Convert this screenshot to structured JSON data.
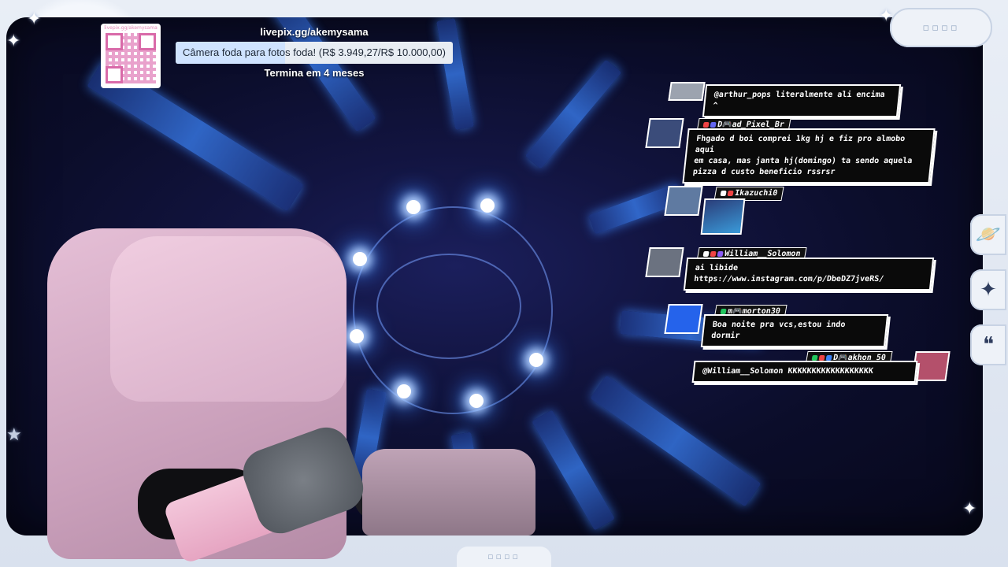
{
  "goal": {
    "url": "livepix.gg/akemysama",
    "qr_label": "livepix.gg/akemysama",
    "title": "Câmera foda para fotos foda! (R$ 3.949,27/R$ 10.000,00)",
    "progress_fraction": 0.3949,
    "ends": "Termina em 4 meses"
  },
  "frame": {
    "top_pill": "▫▫▫▫",
    "bottom_pill": "▫▫▫▫",
    "side_buttons": [
      {
        "icon": "planet-icon",
        "glyph": "🪐"
      },
      {
        "icon": "sparkle-star-icon",
        "glyph": "✦"
      },
      {
        "icon": "quote-icon",
        "glyph": "❝"
      }
    ]
  },
  "chat": [
    {
      "user": "",
      "text": "@arthur_pops literalmente ali encima ^"
    },
    {
      "user": "D🎮ad_Pixel_Br",
      "text": "Fhgado d boi comprei 1kg hj e fiz pro almobo aqui\nem casa, mas janta hj(domingo) ta sendo aquela\npizza d custo beneficio rssrsr"
    },
    {
      "user": "Ikazuchi0",
      "text": ""
    },
    {
      "user": "William__Solomon",
      "text": "ai libide\nhttps://www.instagram.com/p/DbeDZ7jveRS/"
    },
    {
      "user": "m🎮morton30",
      "text": "Boa noite pra vcs,estou indo dormir"
    },
    {
      "user": "D🎮akhon_50",
      "text": "@William__Solomon KKKKKKKKKKKKKKKKKK"
    }
  ],
  "colors": {
    "accent_pink": "#e48bc0",
    "scene_bg": "#0b0d2a",
    "chat_bubble": "#0a0a0a"
  }
}
